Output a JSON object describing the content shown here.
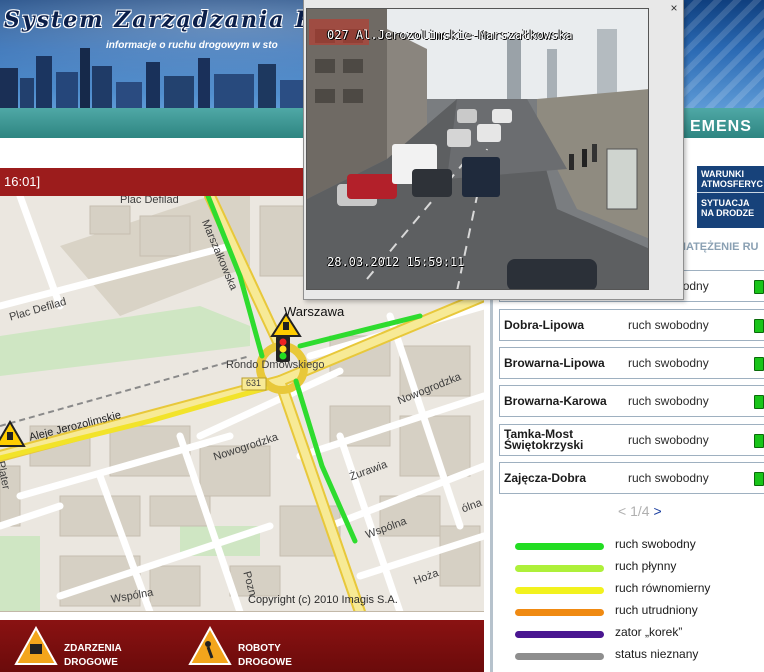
{
  "header": {
    "title": "System Zarządzania Ruc",
    "subtitle": "informacje o ruchu drogowym w sto",
    "partner": "EMENS"
  },
  "time_bar": {
    "text": "16:01]"
  },
  "map": {
    "labels": {
      "plac_defilad_top": "Plac Defilad",
      "plac_defilad": "Plac Defilad",
      "marszalkowska": "Marszałkowska",
      "warszawa": "Warszawa",
      "rondo": "Rondo Dmowskiego",
      "road_631": "631",
      "aleje": "Aleje Jerozolimskie",
      "nowogrodzka_1": "Nowogrodzka",
      "nowogrodzka_2": "Nowogrodzka",
      "zurawia": "Żurawia",
      "wspolna_1": "Wspólna",
      "wspolna_2": "Wspólna",
      "hoza": "Hoża",
      "plater": "Plater",
      "poznanska": "Pozn",
      "olna": "ólna"
    },
    "copyright": "Copyright (c) 2010 Imagis S.A."
  },
  "bottom": {
    "incidents": "ZDARZENIA DROGOWE",
    "roadworks": "ROBOTY DROGOWE"
  },
  "sidebar": {
    "tabs": [
      "WARUNKI ATMOSFERYC",
      "SYTUACJA NA DRODZE"
    ],
    "section_title": "NATĘŻENIE RU",
    "rows": [
      {
        "location": "",
        "status": "ruch swobodny"
      },
      {
        "location": "Dobra-Lipowa",
        "status": "ruch swobodny"
      },
      {
        "location": "Browarna-Lipowa",
        "status": "ruch swobodny"
      },
      {
        "location": "Browarna-Karowa",
        "status": "ruch swobodny"
      },
      {
        "location": "Tamka-Most Świętokrzyski",
        "status": "ruch swobodny"
      },
      {
        "location": "Zajęcza-Dobra",
        "status": "ruch swobodny"
      }
    ],
    "pager": {
      "prev": "<",
      "page": "1/4",
      "next": ">"
    },
    "legend": [
      {
        "label": "ruch swobodny",
        "color": "#22dd22"
      },
      {
        "label": "ruch płynny",
        "color": "#aef03a"
      },
      {
        "label": "ruch równomierny",
        "color": "#f2f21e"
      },
      {
        "label": "ruch utrudniony",
        "color": "#f08a12"
      },
      {
        "label": "zator „korek”",
        "color": "#4a1691"
      },
      {
        "label": "status nieznany",
        "color": "#8e8e8e"
      }
    ]
  },
  "camera": {
    "title": "027 Al.Jerozolimskie-Marszałkowska",
    "timestamp": "28.03.2012 15:59:11",
    "close": "×"
  }
}
